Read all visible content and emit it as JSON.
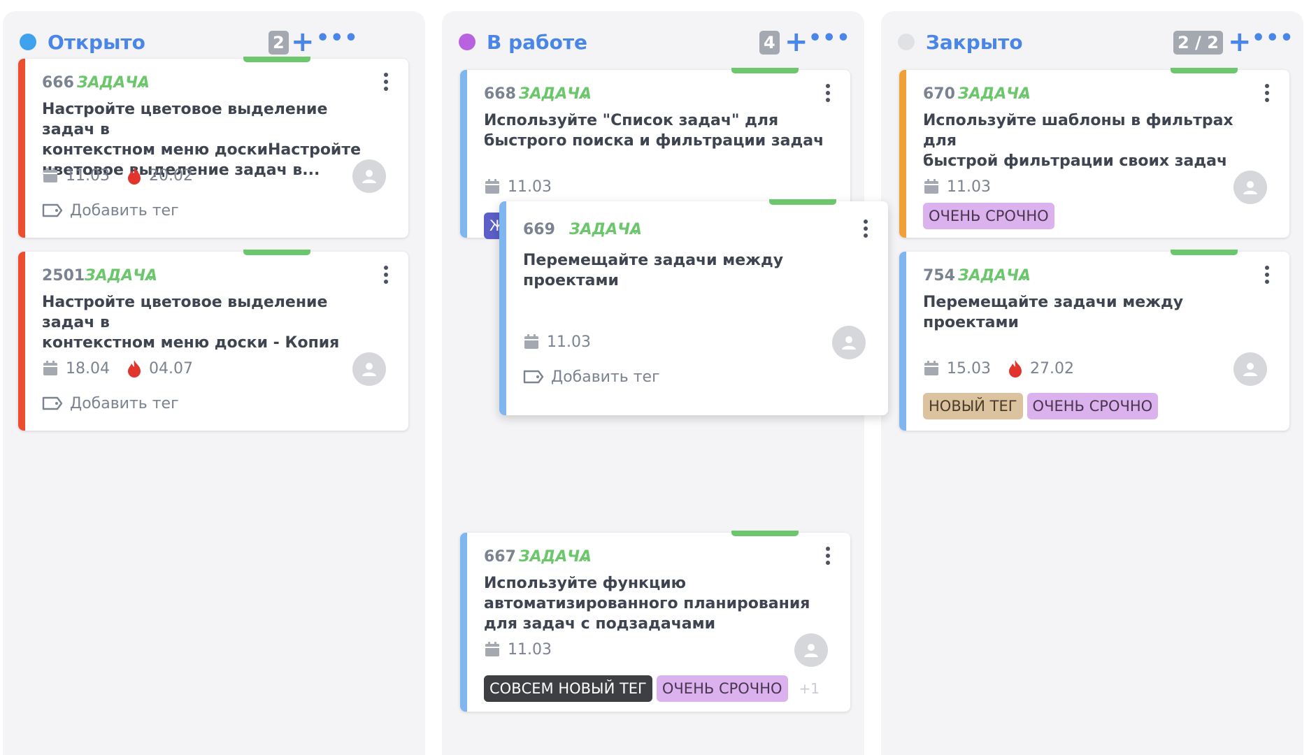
{
  "colors": {
    "accent": "#4a86e8",
    "green": "#6cc76c",
    "count_badge": "#a3a8b1"
  },
  "columns": [
    {
      "title": "Открыто",
      "dot_color": "#3ea3ec",
      "count": "2",
      "cards": [
        {
          "number": "666",
          "type": "ЗАДАЧА",
          "bar_color": "#ec4d2e",
          "title_lines": [
            "Настройте цветовое выделение задач в",
            "контекстном меню доскиНастройте",
            "цветовое выделение задач в..."
          ],
          "date": "11.03",
          "deadline": "20.02",
          "add_tag_label": "Добавить тег",
          "tags": []
        },
        {
          "number": "2501",
          "type": "ЗАДАЧА",
          "bar_color": "#ec4d2e",
          "title_lines": [
            "Настройте цветовое выделение задач в",
            "контекстном меню доски - Копия"
          ],
          "date": "18.04",
          "deadline": "04.07",
          "add_tag_label": "Добавить тег",
          "tags": []
        }
      ]
    },
    {
      "title": "В работе",
      "dot_color": "#b962e0",
      "count": "4",
      "cards": [
        {
          "number": "668",
          "type": "ЗАДАЧА",
          "bar_color": "#7fb6ef",
          "title_lines": [
            "Используйте \"Список задач\" для",
            "быстрого поиска и фильтрации задач"
          ],
          "date": "11.03",
          "tag_peek": "Ж",
          "tags": []
        },
        {
          "number": "669",
          "type": "ЗАДАЧА",
          "bar_color": "#7fb6ef",
          "title_lines": [
            "Перемещайте задачи между проектами"
          ],
          "date": "11.03",
          "add_tag_label": "Добавить тег",
          "tags": []
        },
        {
          "number": "667",
          "type": "ЗАДАЧА",
          "bar_color": "#7fb6ef",
          "title_lines": [
            "Используйте функцию",
            "автоматизированного планирования",
            "для задач с подзадачами"
          ],
          "date": "11.03",
          "tags": [
            {
              "label": "СОВСЕМ НОВЫЙ ТЕГ",
              "bg": "#3d3f42",
              "fg": "#ffffff"
            },
            {
              "label": "ОЧЕНЬ СРОЧНО",
              "bg": "#dcb2ee",
              "fg": "#4a3550"
            }
          ],
          "more_tags": "+1"
        }
      ]
    },
    {
      "title": "Закрыто",
      "dot_color": "#dfe1e5",
      "count": "2 / 2",
      "cards": [
        {
          "number": "670",
          "type": "ЗАДАЧА",
          "bar_color": "#f0a037",
          "title_lines": [
            "Используйте шаблоны в фильтрах для",
            "быстрой фильтрации своих задач"
          ],
          "date": "11.03",
          "tags": [
            {
              "label": "ОЧЕНЬ СРОЧНО",
              "bg": "#dcb2ee",
              "fg": "#4a3550"
            }
          ]
        },
        {
          "number": "754",
          "type": "ЗАДАЧА",
          "bar_color": "#7fb6ef",
          "title_lines": [
            "Перемещайте задачи между проектами"
          ],
          "date": "15.03",
          "deadline": "27.02",
          "tags": [
            {
              "label": "НОВЫЙ ТЕГ",
              "bg": "#dcc3a0",
              "fg": "#4a3b2a"
            },
            {
              "label": "ОЧЕНЬ СРОЧНО",
              "bg": "#dcb2ee",
              "fg": "#4a3550"
            }
          ]
        }
      ]
    }
  ]
}
